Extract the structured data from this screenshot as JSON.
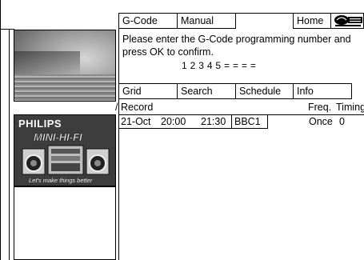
{
  "top_tabs": {
    "gcode": "G-Code",
    "manual": "Manual",
    "home": "Home",
    "logo_alt": "GUIDE Plus+ GEMSTAR"
  },
  "message": {
    "line1": "Please enter the G-Code programming number and",
    "line2": "press OK to confirm.",
    "code_entry": "1 2 3 4 5 = = = ="
  },
  "bottom_tabs": {
    "grid": "Grid",
    "search": "Search",
    "schedule": "Schedule",
    "info": "Info"
  },
  "record_section": {
    "prefix": "/",
    "title": "Record",
    "freq_header": "Freq.",
    "timing_header": "Timing"
  },
  "record_rows": [
    {
      "date": "21-Oct",
      "start": "20:00",
      "end": "21:30",
      "channel": "BBC1",
      "freq": "Once",
      "timing": "0"
    }
  ],
  "advert": {
    "brand": "PHILIPS",
    "product": "MINI-HI-FI",
    "tagline": "Let's make things better"
  }
}
